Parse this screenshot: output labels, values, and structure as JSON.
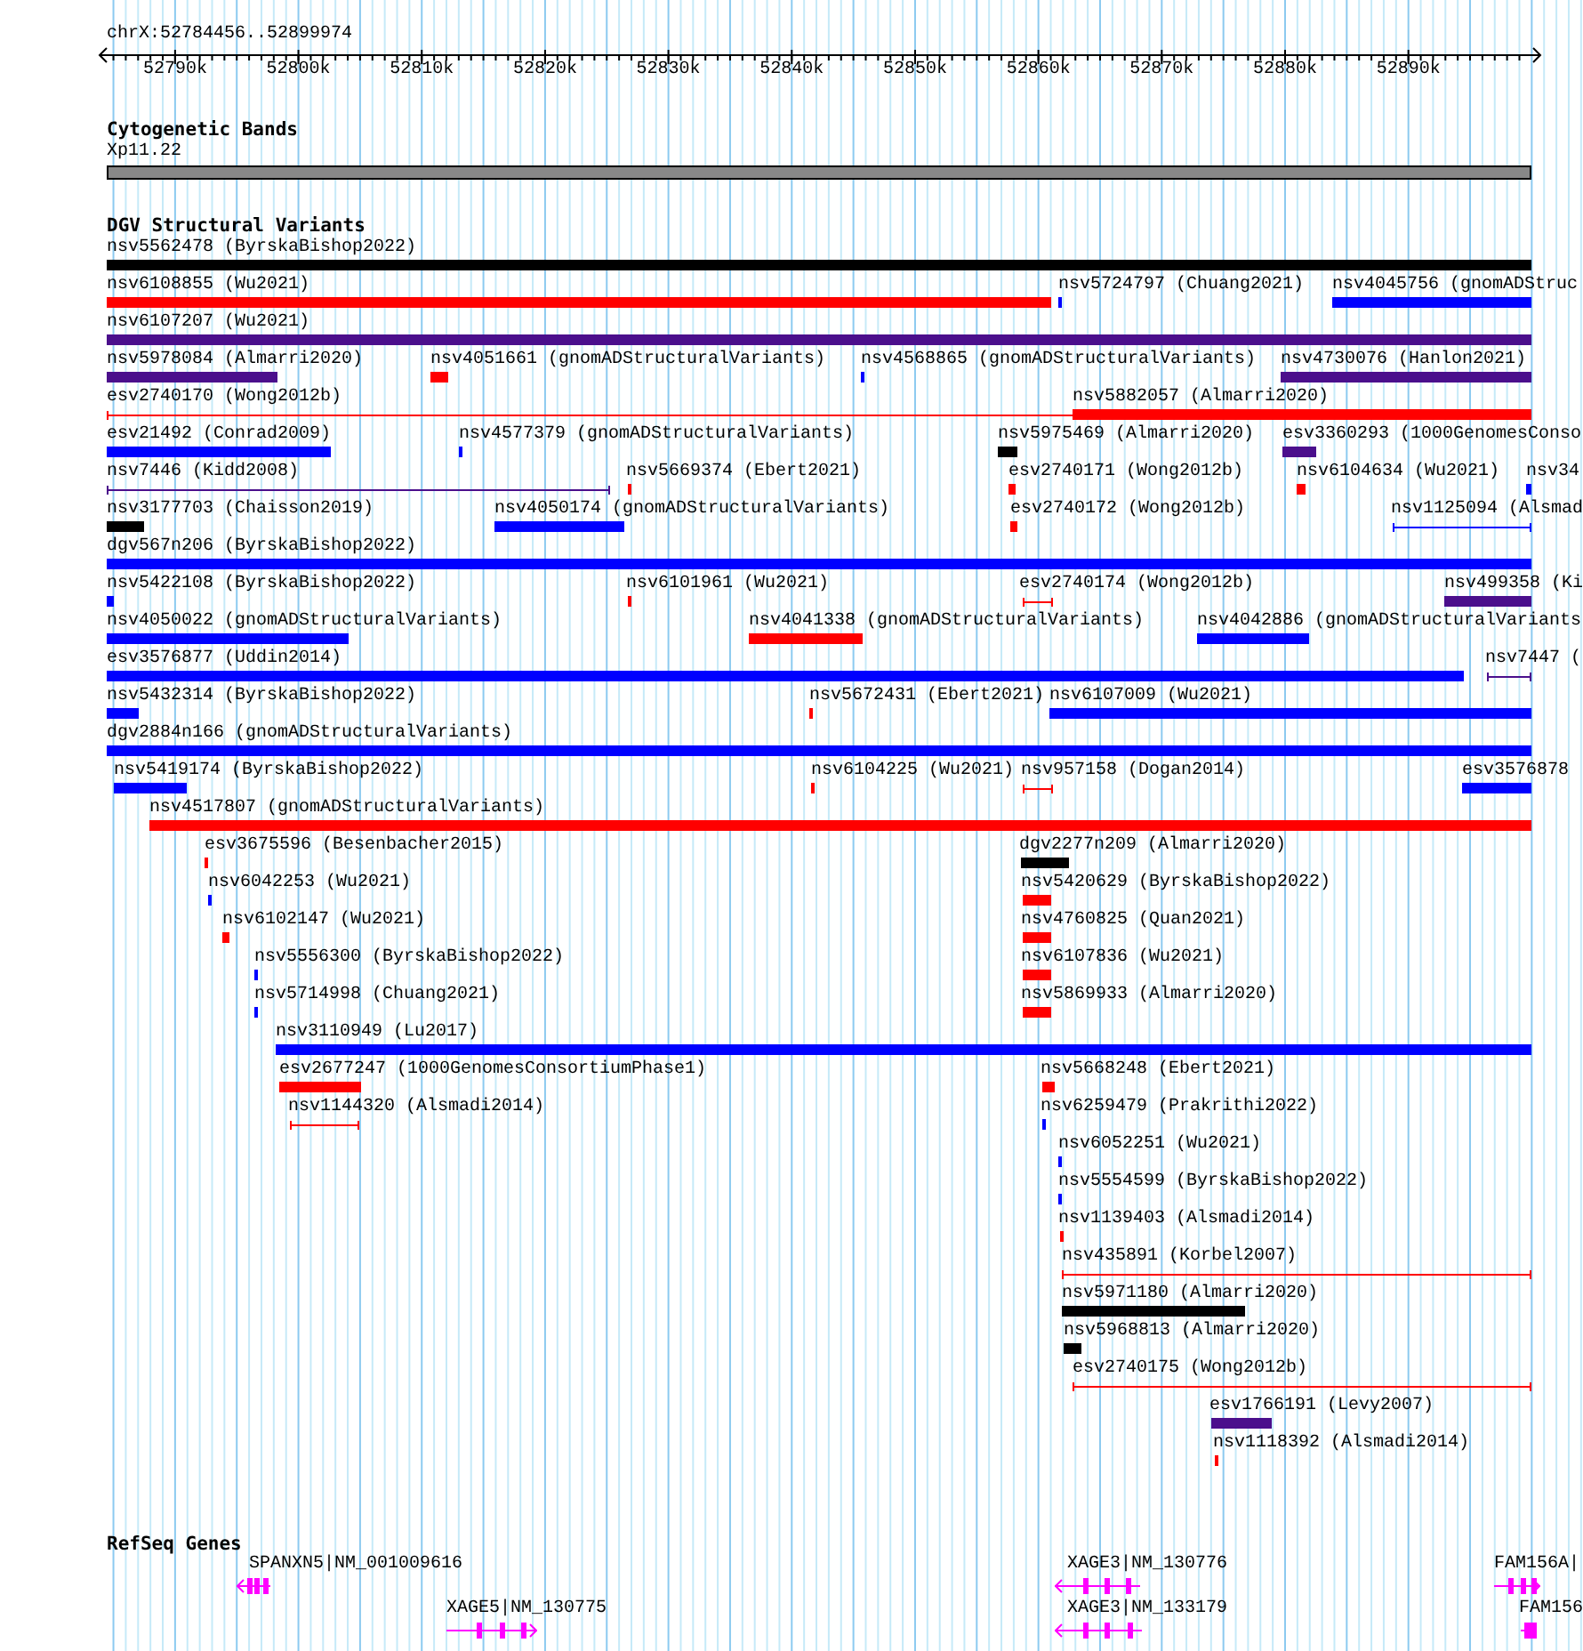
{
  "ruler": {
    "locus": "chrX:52784456..52899974",
    "ticks": [
      "52790k",
      "52800k",
      "52810k",
      "52820k",
      "52830k",
      "52840k",
      "52850k",
      "52860k",
      "52870k",
      "52880k",
      "52890k"
    ]
  },
  "cytoband": {
    "title": "Cytogenetic Bands",
    "band": "Xp11.22"
  },
  "variants": {
    "title": "DGV Structural Variants",
    "rows": [
      {
        "features": [
          {
            "label": "nsv5562478 (ByrskaBishop2022)",
            "kind": "block",
            "color": "#000000"
          }
        ]
      },
      {
        "features": [
          {
            "label": "nsv6108855 (Wu2021)",
            "kind": "block",
            "color": "#ff0000"
          },
          {
            "label": "nsv5724797 (Chuang2021)",
            "kind": "block",
            "color": "#0000ff"
          },
          {
            "label": "nsv4045756 (gnomADStruc",
            "kind": "block",
            "color": "#0000ff"
          }
        ]
      },
      {
        "features": [
          {
            "label": "nsv6107207 (Wu2021)",
            "kind": "block",
            "color": "#4b0f8c"
          }
        ]
      },
      {
        "features": [
          {
            "label": "nsv5978084 (Almarri2020)",
            "kind": "block",
            "color": "#4b0f8c"
          },
          {
            "label": "nsv4051661 (gnomADStructuralVariants)",
            "kind": "block",
            "color": "#ff0000"
          },
          {
            "label": "nsv4568865 (gnomADStructuralVariants)",
            "kind": "block",
            "color": "#0000ff"
          },
          {
            "label": "nsv4730076 (Hanlon2021)",
            "kind": "block",
            "color": "#4b0f8c"
          }
        ]
      },
      {
        "features": [
          {
            "label": "esv2740170 (Wong2012b)",
            "kind": "span",
            "color": "#ff0000"
          },
          {
            "label": "nsv5882057 (Almarri2020)",
            "kind": "block",
            "color": "#ff0000"
          }
        ]
      },
      {
        "features": [
          {
            "label": "esv21492 (Conrad2009)",
            "kind": "block",
            "color": "#0000ff"
          },
          {
            "label": "nsv4577379 (gnomADStructuralVariants)",
            "kind": "block",
            "color": "#0000ff"
          },
          {
            "label": "nsv5975469 (Almarri2020)",
            "kind": "block",
            "color": "#000000"
          },
          {
            "label": "esv3360293 (1000GenomesConso",
            "kind": "block",
            "color": "#4b0f8c"
          }
        ]
      },
      {
        "features": [
          {
            "label": "nsv7446 (Kidd2008)",
            "kind": "span",
            "color": "#4b0f8c"
          },
          {
            "label": "nsv5669374 (Ebert2021)",
            "kind": "block",
            "color": "#ff0000"
          },
          {
            "label": "esv2740171 (Wong2012b)",
            "kind": "block",
            "color": "#ff0000"
          },
          {
            "label": "nsv6104634 (Wu2021)",
            "kind": "block",
            "color": "#ff0000"
          },
          {
            "label": "nsv34",
            "kind": "block",
            "color": "#0000ff"
          }
        ]
      },
      {
        "features": [
          {
            "label": "nsv3177703 (Chaisson2019)",
            "kind": "block",
            "color": "#000000"
          },
          {
            "label": "nsv4050174 (gnomADStructuralVariants)",
            "kind": "block",
            "color": "#0000ff"
          },
          {
            "label": "esv2740172 (Wong2012b)",
            "kind": "block",
            "color": "#ff0000"
          },
          {
            "label": "nsv1125094 (Alsmad",
            "kind": "span",
            "color": "#0000ff"
          }
        ]
      },
      {
        "features": [
          {
            "label": "dgv567n206 (ByrskaBishop2022)",
            "kind": "block",
            "color": "#0000ff"
          }
        ]
      },
      {
        "features": [
          {
            "label": "nsv5422108 (ByrskaBishop2022)",
            "kind": "block",
            "color": "#0000ff"
          },
          {
            "label": "nsv6101961 (Wu2021)",
            "kind": "block",
            "color": "#ff0000"
          },
          {
            "label": "esv2740174 (Wong2012b)",
            "kind": "span",
            "color": "#ff0000"
          },
          {
            "label": "nsv499358 (Ki",
            "kind": "block",
            "color": "#4b0f8c"
          }
        ]
      },
      {
        "features": [
          {
            "label": "nsv4050022 (gnomADStructuralVariants)",
            "kind": "block",
            "color": "#0000ff"
          },
          {
            "label": "nsv4041338 (gnomADStructuralVariants)",
            "kind": "block",
            "color": "#ff0000"
          },
          {
            "label": "nsv4042886 (gnomADStructuralVariants",
            "kind": "block",
            "color": "#0000ff"
          }
        ]
      },
      {
        "features": [
          {
            "label": "esv3576877 (Uddin2014)",
            "kind": "block",
            "color": "#0000ff"
          },
          {
            "label": "nsv7447 (",
            "kind": "span",
            "color": "#4b0f8c"
          }
        ]
      },
      {
        "features": [
          {
            "label": "nsv5432314 (ByrskaBishop2022)",
            "kind": "block",
            "color": "#0000ff"
          },
          {
            "label": "nsv5672431 (Ebert2021)",
            "kind": "block",
            "color": "#ff0000"
          },
          {
            "label": "nsv6107009 (Wu2021)",
            "kind": "block",
            "color": "#0000ff"
          }
        ]
      },
      {
        "features": [
          {
            "label": "dgv2884n166 (gnomADStructuralVariants)",
            "kind": "block",
            "color": "#0000ff"
          }
        ]
      },
      {
        "features": [
          {
            "label": "nsv5419174 (ByrskaBishop2022)",
            "kind": "block",
            "color": "#0000ff"
          },
          {
            "label": "nsv6104225 (Wu2021)",
            "kind": "block",
            "color": "#ff0000"
          },
          {
            "label": "nsv957158 (Dogan2014)",
            "kind": "span",
            "color": "#ff0000"
          },
          {
            "label": "esv3576878",
            "kind": "block",
            "color": "#0000ff"
          }
        ]
      },
      {
        "features": [
          {
            "label": "nsv4517807 (gnomADStructuralVariants)",
            "kind": "block",
            "color": "#ff0000"
          }
        ]
      },
      {
        "features": [
          {
            "label": "esv3675596 (Besenbacher2015)",
            "kind": "block",
            "color": "#ff0000"
          },
          {
            "label": "dgv2277n209 (Almarri2020)",
            "kind": "block",
            "color": "#000000"
          }
        ]
      },
      {
        "features": [
          {
            "label": "nsv6042253 (Wu2021)",
            "kind": "block",
            "color": "#0000ff"
          },
          {
            "label": "nsv5420629 (ByrskaBishop2022)",
            "kind": "block",
            "color": "#ff0000"
          }
        ]
      },
      {
        "features": [
          {
            "label": "nsv6102147 (Wu2021)",
            "kind": "block",
            "color": "#ff0000"
          },
          {
            "label": "nsv4760825 (Quan2021)",
            "kind": "block",
            "color": "#ff0000"
          }
        ]
      },
      {
        "features": [
          {
            "label": "nsv5556300 (ByrskaBishop2022)",
            "kind": "block",
            "color": "#0000ff"
          },
          {
            "label": "nsv6107836 (Wu2021)",
            "kind": "block",
            "color": "#ff0000"
          }
        ]
      },
      {
        "features": [
          {
            "label": "nsv5714998 (Chuang2021)",
            "kind": "block",
            "color": "#0000ff"
          },
          {
            "label": "nsv5869933 (Almarri2020)",
            "kind": "block",
            "color": "#ff0000"
          }
        ]
      },
      {
        "features": [
          {
            "label": "nsv3110949 (Lu2017)",
            "kind": "block",
            "color": "#0000ff"
          }
        ]
      },
      {
        "features": [
          {
            "label": "esv2677247 (1000GenomesConsortiumPhase1)",
            "kind": "block",
            "color": "#ff0000"
          },
          {
            "label": "nsv5668248 (Ebert2021)",
            "kind": "block",
            "color": "#ff0000"
          }
        ]
      },
      {
        "features": [
          {
            "label": "nsv1144320 (Alsmadi2014)",
            "kind": "span",
            "color": "#ff0000"
          },
          {
            "label": "nsv6259479 (Prakrithi2022)",
            "kind": "block",
            "color": "#0000ff"
          }
        ]
      },
      {
        "features": [
          {
            "label": "nsv6052251 (Wu2021)",
            "kind": "block",
            "color": "#0000ff"
          }
        ]
      },
      {
        "features": [
          {
            "label": "nsv5554599 (ByrskaBishop2022)",
            "kind": "block",
            "color": "#0000ff"
          }
        ]
      },
      {
        "features": [
          {
            "label": "nsv1139403 (Alsmadi2014)",
            "kind": "block",
            "color": "#ff0000"
          }
        ]
      },
      {
        "features": [
          {
            "label": "nsv435891 (Korbel2007)",
            "kind": "span",
            "color": "#ff0000"
          }
        ]
      },
      {
        "features": [
          {
            "label": "nsv5971180 (Almarri2020)",
            "kind": "block",
            "color": "#000000"
          }
        ]
      },
      {
        "features": [
          {
            "label": "nsv5968813 (Almarri2020)",
            "kind": "block",
            "color": "#000000"
          }
        ]
      },
      {
        "features": [
          {
            "label": "esv2740175 (Wong2012b)",
            "kind": "span",
            "color": "#ff0000"
          }
        ]
      },
      {
        "features": [
          {
            "label": "esv1766191 (Levy2007)",
            "kind": "block",
            "color": "#4b0f8c"
          }
        ]
      },
      {
        "features": [
          {
            "label": "nsv1118392 (Alsmadi2014)",
            "kind": "block",
            "color": "#ff0000"
          }
        ]
      }
    ]
  },
  "genes": {
    "title": "RefSeq Genes",
    "items": [
      {
        "label": "SPANXN5|NM_001009616",
        "reverse": true
      },
      {
        "label": "XAGE3|NM_130776",
        "reverse": true
      },
      {
        "label": "FAM156A|",
        "reverse": false
      },
      {
        "label": "XAGE5|NM_130775",
        "reverse": false
      },
      {
        "label": "XAGE3|NM_133179",
        "reverse": true
      },
      {
        "label": "FAM156",
        "reverse": false
      }
    ]
  }
}
